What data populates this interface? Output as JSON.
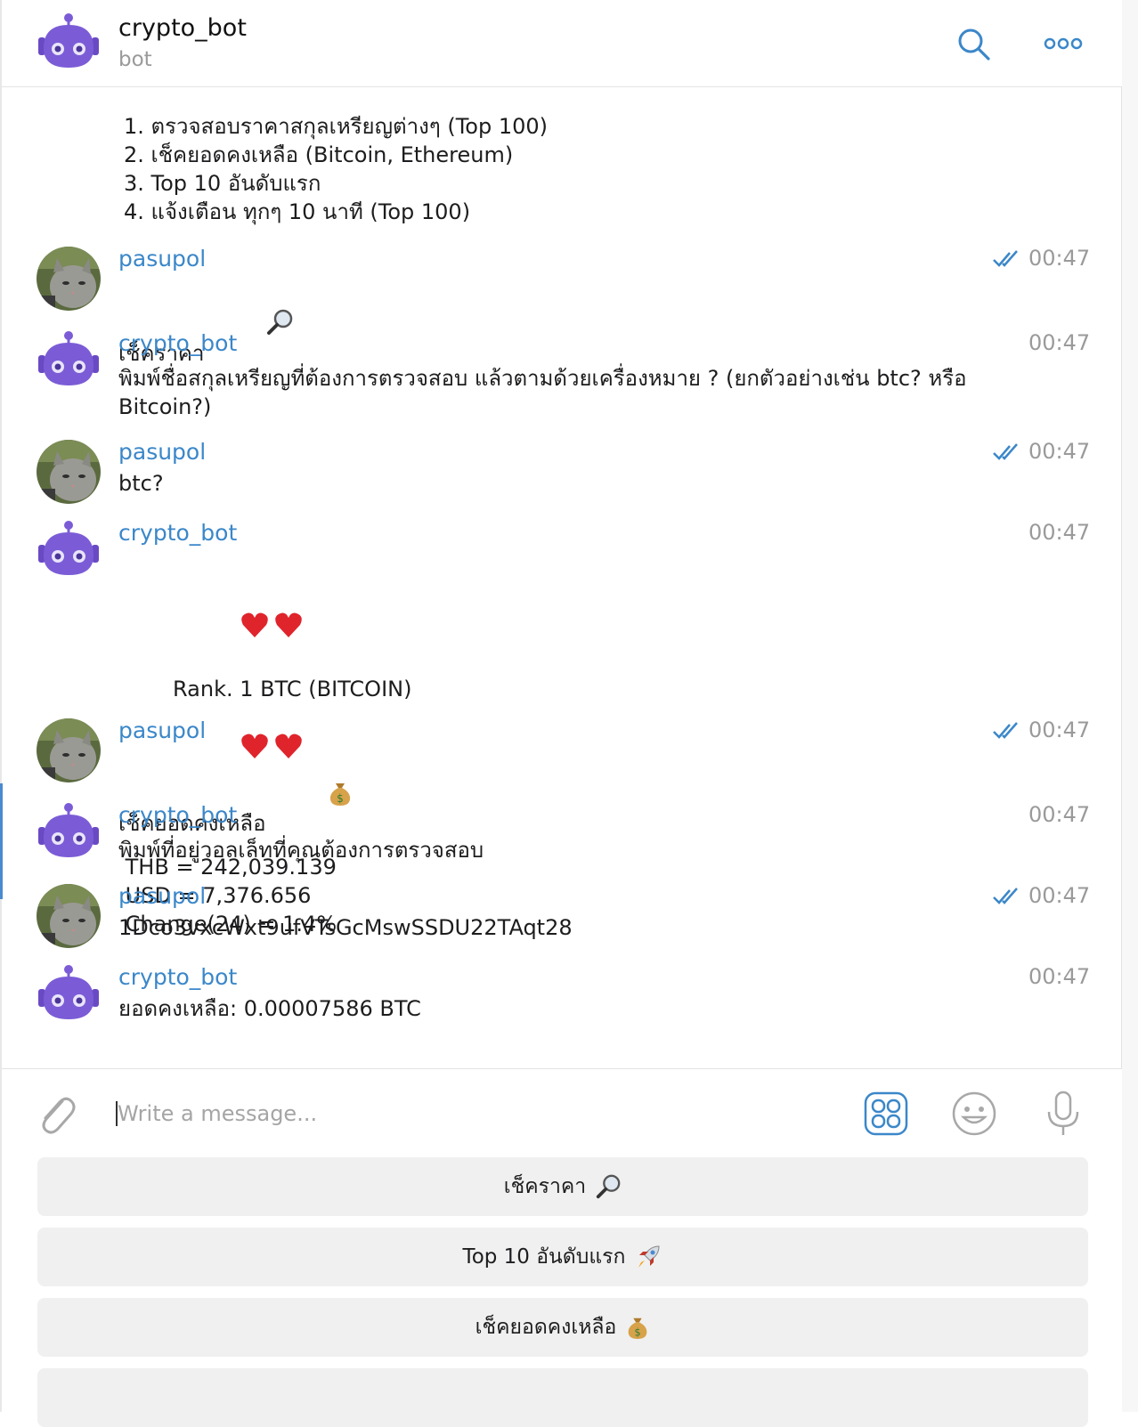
{
  "header": {
    "title": "crypto_bot",
    "subtitle": "bot"
  },
  "intro_lines": [
    "1. ตรวจสอบราคาสกุลเหรียญต่างๆ (Top 100)",
    "2. เช็คยอดคงเหลือ (Bitcoin, Ethereum)",
    "3. Top 10 อันดับแรก",
    "4. แจ้งเตือน ทุกๆ 10 นาที (Top 100)"
  ],
  "messages": [
    {
      "sender": "pasupol",
      "time": "00:47",
      "lines": [
        "เช็คราคา"
      ],
      "emoji": "magnifier-icon"
    },
    {
      "sender": "crypto_bot",
      "time": "00:47",
      "lines": [
        "พิมพ์ชื่อสกุลเหรียญที่ต้องการตรวจสอบ แล้วตามด้วยเครื่องหมาย ? (ยกตัวอย่างเช่น btc? หรือ",
        "Bitcoin?)"
      ]
    },
    {
      "sender": "pasupol",
      "time": "00:47",
      "lines": [
        "btc?"
      ]
    },
    {
      "sender": "crypto_bot",
      "time": "00:47",
      "lines": [
        "Rank. 1 BTC (BITCOIN)",
        "",
        " THB = 242,039.139",
        " USD = 7,376.656",
        " Change(24) = 1.4%"
      ]
    },
    {
      "sender": "pasupol",
      "time": "00:47",
      "lines": [
        "เช็คยอดคงเหลือ"
      ],
      "emoji": "money-bag-icon"
    },
    {
      "sender": "crypto_bot",
      "time": "00:47",
      "lines": [
        "พิมพ์ที่อยู่วอลเล็ทที่คุณต้องการตรวจสอบ"
      ]
    },
    {
      "sender": "pasupol",
      "time": "00:47",
      "lines": [
        "1Dco3vxcWxt9ufVTsGcMswSSDU22TAqt28"
      ]
    },
    {
      "sender": "crypto_bot",
      "time": "00:47",
      "lines": [
        "ยอดคงเหลือ: 0.00007586 BTC"
      ]
    }
  ],
  "input": {
    "placeholder": "Write a message..."
  },
  "keyboard_buttons": [
    {
      "label": "เช็คราคา",
      "icon": "magnifier-icon"
    },
    {
      "label": "Top 10 อันดับแรก",
      "icon": "rocket-icon"
    },
    {
      "label": "เช็คยอดคงเหลือ",
      "icon": "money-bag-icon"
    },
    {
      "label": "",
      "icon": ""
    }
  ],
  "colors": {
    "accent": "#3b87c9",
    "bot_avatar": "#7b5cd6",
    "heart": "#e0242c"
  }
}
